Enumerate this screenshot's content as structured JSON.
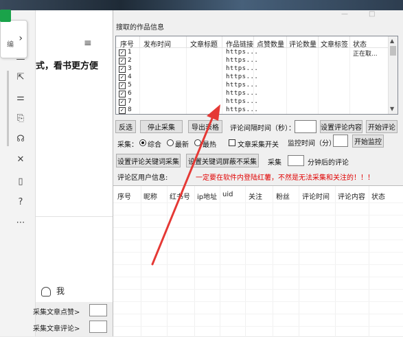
{
  "left_panel": {
    "rail_tab_text": "编",
    "promo_text": "式，看书更方便",
    "me_label": "我",
    "bottom_rows": [
      "采集文章点赞>",
      "采集文章评论>"
    ]
  },
  "dialog": {
    "group_title": "搜取的作品信息",
    "works_table": {
      "columns": [
        "序号",
        "发布时间",
        "文章标题",
        "作品链接",
        "点赞数量",
        "评论数量",
        "文章标签",
        "状态"
      ],
      "rows": [
        {
          "num": "1",
          "link": "https...",
          "status": "正在取..."
        },
        {
          "num": "2",
          "link": "https...",
          "status": ""
        },
        {
          "num": "3",
          "link": "https...",
          "status": ""
        },
        {
          "num": "4",
          "link": "https...",
          "status": ""
        },
        {
          "num": "5",
          "link": "https...",
          "status": ""
        },
        {
          "num": "6",
          "link": "https...",
          "status": ""
        },
        {
          "num": "7",
          "link": "https...",
          "status": ""
        },
        {
          "num": "8",
          "link": "https...",
          "status": ""
        }
      ]
    },
    "buttons": {
      "invert_select": "反选",
      "stop_collect": "停止采集",
      "export_table": "导出表格",
      "set_comment": "设置评论内容",
      "start_comment": "开始评论",
      "start_monitor": "开始监控",
      "set_keyword_collect": "设置评论关键词采集",
      "set_keyword_block": "设置关键词屏蔽不采集"
    },
    "labels": {
      "comment_interval": "评论间隔时间（秒）：",
      "collect": "采集：",
      "radio_all": "综合",
      "radio_newest": "最新",
      "radio_hottest": "最热",
      "article_switch": "文章采集开关",
      "monitor_time": "监控时间（分）",
      "collect2": "采集",
      "after_minutes": "分钟后的评论",
      "comment_user_info": "评论区用户信息:",
      "warning": "一定要在软件内登陆红薯，不然是无法采集和关注的！！！"
    },
    "users_table": {
      "columns": [
        "序号",
        "昵称",
        "红书号",
        "ip地址",
        "uid",
        "关注",
        "粉丝",
        "评论时间",
        "评论内容",
        "状态"
      ]
    }
  },
  "colors": {
    "warning": "#e00000",
    "arrow": "#e53935",
    "accent_border": "#0078d7"
  }
}
